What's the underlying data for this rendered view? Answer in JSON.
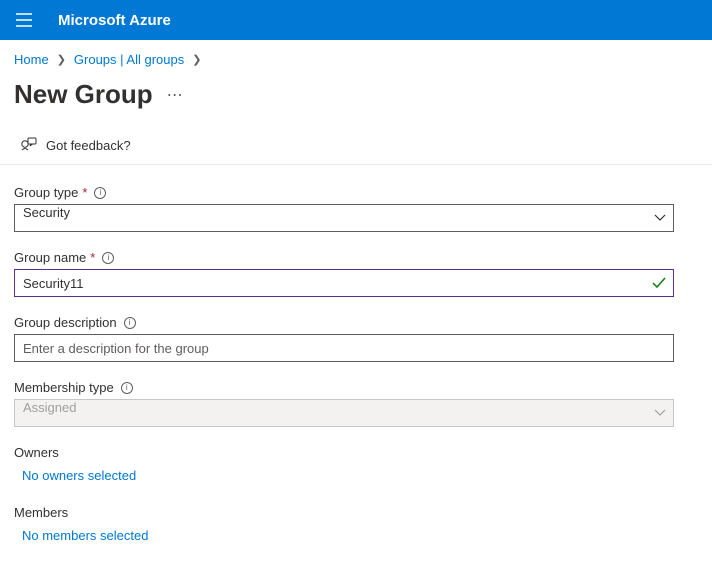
{
  "header": {
    "brand": "Microsoft Azure"
  },
  "breadcrumb": {
    "home": "Home",
    "groups": "Groups | All groups"
  },
  "page": {
    "title": "New Group"
  },
  "feedback": {
    "label": "Got feedback?"
  },
  "form": {
    "group_type": {
      "label": "Group type",
      "value": "Security"
    },
    "group_name": {
      "label": "Group name",
      "value": "Security11"
    },
    "group_description": {
      "label": "Group description",
      "placeholder": "Enter a description for the group"
    },
    "membership_type": {
      "label": "Membership type",
      "value": "Assigned"
    },
    "owners": {
      "label": "Owners",
      "link": "No owners selected"
    },
    "members": {
      "label": "Members",
      "link": "No members selected"
    }
  }
}
